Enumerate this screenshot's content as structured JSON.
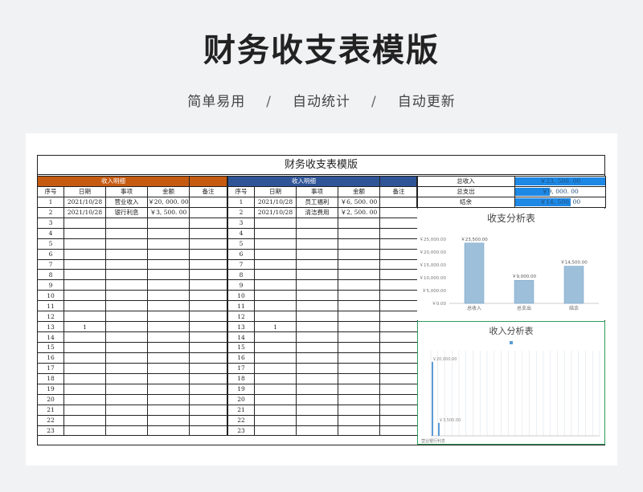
{
  "header": {
    "title": "财务收支表模版",
    "tags": [
      "简单易用",
      "自动统计",
      "自动更新"
    ],
    "separator": "/"
  },
  "sheet": {
    "title": "财务收支表模版",
    "income_table": {
      "section_label": "收入明细",
      "columns": [
        "序号",
        "日期",
        "事项",
        "金额",
        "备注"
      ],
      "rows": [
        [
          "1",
          "2021/10/28",
          "营业收入",
          "￥20, 000. 00",
          ""
        ],
        [
          "2",
          "2021/10/28",
          "银行利息",
          "￥3, 500. 00",
          ""
        ],
        [
          "3",
          "",
          "",
          "",
          ""
        ],
        [
          "4",
          "",
          "",
          "",
          ""
        ],
        [
          "5",
          "",
          "",
          "",
          ""
        ],
        [
          "6",
          "",
          "",
          "",
          ""
        ],
        [
          "7",
          "",
          "",
          "",
          ""
        ],
        [
          "8",
          "",
          "",
          "",
          ""
        ],
        [
          "9",
          "",
          "",
          "",
          ""
        ],
        [
          "10",
          "",
          "",
          "",
          ""
        ],
        [
          "11",
          "",
          "",
          "",
          ""
        ],
        [
          "12",
          "",
          "",
          "",
          ""
        ],
        [
          "13",
          "1",
          "",
          "",
          ""
        ],
        [
          "14",
          "",
          "",
          "",
          ""
        ],
        [
          "15",
          "",
          "",
          "",
          ""
        ],
        [
          "16",
          "",
          "",
          "",
          ""
        ],
        [
          "17",
          "",
          "",
          "",
          ""
        ],
        [
          "18",
          "",
          "",
          "",
          ""
        ],
        [
          "19",
          "",
          "",
          "",
          ""
        ],
        [
          "20",
          "",
          "",
          "",
          ""
        ],
        [
          "21",
          "",
          "",
          "",
          ""
        ],
        [
          "22",
          "",
          "",
          "",
          ""
        ],
        [
          "23",
          "",
          "",
          "",
          ""
        ]
      ]
    },
    "expense_table": {
      "section_label": "收入明细",
      "columns": [
        "序号",
        "日期",
        "事项",
        "金额",
        "备注"
      ],
      "rows": [
        [
          "1",
          "2021/10/28",
          "员工福利",
          "￥6, 500. 00",
          ""
        ],
        [
          "2",
          "2021/10/28",
          "清洁费用",
          "￥2, 500. 00",
          ""
        ],
        [
          "3",
          "",
          "",
          "",
          ""
        ],
        [
          "4",
          "",
          "",
          "",
          ""
        ],
        [
          "5",
          "",
          "",
          "",
          ""
        ],
        [
          "6",
          "",
          "",
          "",
          ""
        ],
        [
          "7",
          "",
          "",
          "",
          ""
        ],
        [
          "8",
          "",
          "",
          "",
          ""
        ],
        [
          "9",
          "",
          "",
          "",
          ""
        ],
        [
          "10",
          "",
          "",
          "",
          ""
        ],
        [
          "11",
          "",
          "",
          "",
          ""
        ],
        [
          "12",
          "",
          "",
          "",
          ""
        ],
        [
          "13",
          "1",
          "",
          "",
          ""
        ],
        [
          "14",
          "",
          "",
          "",
          ""
        ],
        [
          "15",
          "",
          "",
          "",
          ""
        ],
        [
          "16",
          "",
          "",
          "",
          ""
        ],
        [
          "17",
          "",
          "",
          "",
          ""
        ],
        [
          "18",
          "",
          "",
          "",
          ""
        ],
        [
          "19",
          "",
          "",
          "",
          ""
        ],
        [
          "20",
          "",
          "",
          "",
          ""
        ],
        [
          "21",
          "",
          "",
          "",
          ""
        ],
        [
          "22",
          "",
          "",
          "",
          ""
        ],
        [
          "23",
          "",
          "",
          "",
          ""
        ]
      ]
    },
    "summary": [
      {
        "label": "总收入",
        "value": "￥23, 500. 00",
        "fill": 1.0
      },
      {
        "label": "总支出",
        "value": "￥9, 000. 00",
        "fill": 0.38
      },
      {
        "label": "结余",
        "value": "￥14, 500. 00",
        "fill": 0.62
      }
    ]
  },
  "colors": {
    "income_header": "#c55a11",
    "expense_header": "#2f5597",
    "data_bar": "#1e88e5",
    "chart_bar": "#9dbfda",
    "chart_bar_stroke": "#6f9fc6"
  },
  "chart_data": [
    {
      "type": "bar",
      "title": "收支分析表",
      "categories": [
        "总收入",
        "总支出",
        "结余"
      ],
      "values": [
        23500,
        9000,
        14500
      ],
      "data_labels": [
        "￥23,500.00",
        "￥9,000.00",
        "￥14,500.00"
      ],
      "ylim": [
        0,
        25000
      ],
      "yticks": [
        0,
        5000,
        10000,
        15000,
        20000,
        25000
      ],
      "ytick_labels": [
        "￥0.00",
        "￥5,000.00",
        "￥10,000.00",
        "￥15,000.00",
        "￥20,000.00",
        "￥25,000.00"
      ],
      "grid": false,
      "legend": "none"
    },
    {
      "type": "bar",
      "title": "收入分析表",
      "categories": [
        "营业收入",
        "银行利息"
      ],
      "values": [
        20000,
        3500
      ],
      "data_labels": [
        "￥20,000.00",
        "￥3,500.00"
      ],
      "x_label_text": "营业银行利息",
      "ylim": [
        0,
        23000
      ],
      "grid": true,
      "legend": "top"
    }
  ]
}
